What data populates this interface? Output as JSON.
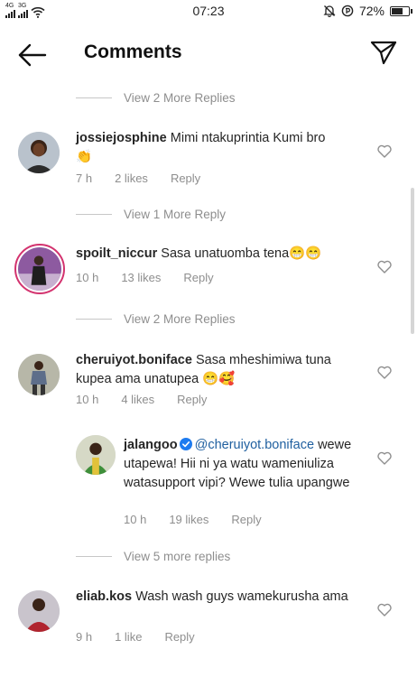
{
  "status_bar": {
    "time": "07:23",
    "battery": "72%",
    "battery_level": 0.72,
    "signal_labels": [
      "4G",
      "3G"
    ]
  },
  "header": {
    "title": "Comments",
    "back_icon": "arrow-left-icon",
    "send_icon": "paper-plane-icon"
  },
  "replies_toggles": [
    {
      "label": "View 2 More Replies"
    },
    {
      "label": "View 1 More Reply"
    },
    {
      "label": "View 2 More Replies"
    },
    {
      "label": "View 5 more replies"
    }
  ],
  "comments": [
    {
      "username": "jossiejosphine",
      "text": "Mimi ntakuprintia Kumi bro",
      "emoji": "👏",
      "time": "7 h",
      "likes": "2 likes",
      "reply": "Reply"
    },
    {
      "username": "spoilt_niccur",
      "text": "Sasa unatuomba tena",
      "emoji": "😁😁",
      "time": "10 h",
      "likes": "13 likes",
      "reply": "Reply"
    },
    {
      "username": "cheruiyot.boniface",
      "text": "Sasa mheshimiwa tuna kupea ama unatupea",
      "emoji": "😁🥰",
      "time": "10 h",
      "likes": "4 likes",
      "reply": "Reply"
    },
    {
      "username": "jalangoo",
      "mention": "@cheruiyot.boniface",
      "text": "wewe utapewa! Hii ni ya watu wameniuliza watasupport vipi? Wewe tulia upangwe",
      "time": "10 h",
      "likes": "19 likes",
      "reply": "Reply",
      "verified": true
    },
    {
      "username": "eliab.kos",
      "text": "Wash wash guys wamekurusha ama",
      "time": "9 h",
      "likes": "1 like",
      "reply": "Reply"
    }
  ],
  "colors": {
    "text": "#262626",
    "muted": "#8e8e8e",
    "mention": "#1f5f9f",
    "verified": "#1d7bf0",
    "story_ring": "#d3336f"
  }
}
